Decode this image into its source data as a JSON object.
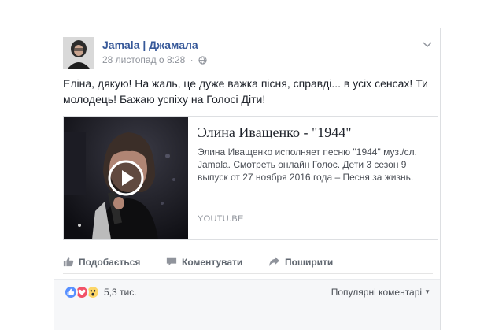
{
  "post": {
    "author": "Jamala | Джамала",
    "timestamp": "28 листопад о 8:28",
    "separator": "·",
    "message": "Еліна, дякую! На жаль, це дуже важка пісня, справді... в усіх сенсах! Ти молодець! Бажаю успіху на Голосі Діти!",
    "menu_icon": "chevron-down-icon",
    "privacy_icon": "globe-icon"
  },
  "link_preview": {
    "title": "Элина Иващенко - \"1944\"",
    "description": "Элина Иващенко исполняет песню \"1944\" муз./сл. Jamala. Смотреть онлайн Голос. Дети 3 сезон 9 выпуск от 27 ноября 2016 года – Песня за жизнь.",
    "domain": "YOUTU.BE",
    "play_icon": "play-icon"
  },
  "actions": {
    "like": "Подобається",
    "comment": "Коментувати",
    "share": "Поширити"
  },
  "reactions": {
    "icons": [
      "like-icon",
      "love-icon",
      "wow-icon"
    ],
    "count": "5,3 тис.",
    "sort_label": "Популярні коментарі"
  },
  "colors": {
    "author_link": "#365899",
    "action_gray": "#606770",
    "like_blue": "#5890ff",
    "love_red": "#f25268",
    "wow_yellow": "#fcd669"
  }
}
